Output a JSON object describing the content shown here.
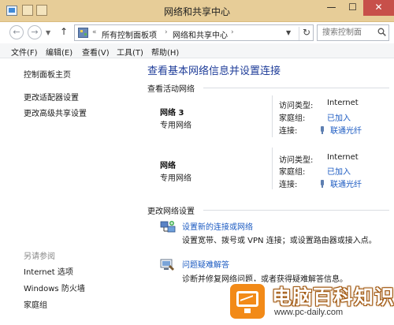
{
  "window": {
    "title": "网络和共享中心",
    "controls": {
      "minimize": "—",
      "maximize": "☐",
      "close": "✕"
    }
  },
  "address": {
    "crumbs": [
      "所有控制面板项",
      "网络和共享中心"
    ],
    "prefix": "«",
    "separator": "›",
    "search_placeholder": "搜索控制面"
  },
  "menu": [
    "文件(F)",
    "编辑(E)",
    "查看(V)",
    "工具(T)",
    "帮助(H)"
  ],
  "sidebar": {
    "items": [
      "控制面板主页",
      "更改适配器设置",
      "更改高级共享设置"
    ],
    "see_also_title": "另请参阅",
    "see_also": [
      "Internet 选项",
      "Windows 防火墙",
      "家庭组"
    ]
  },
  "main": {
    "heading": "查看基本网络信息并设置连接",
    "active_networks_label": "查看活动网络",
    "networks": [
      {
        "name": "网络 3",
        "type": "专用网络",
        "access_type_label": "访问类型:",
        "access_type": "Internet",
        "homegroup_label": "家庭组:",
        "homegroup": "已加入",
        "connection_label": "连接:",
        "connection": "联通光纤"
      },
      {
        "name": "网络",
        "type": "专用网络",
        "access_type_label": "访问类型:",
        "access_type": "Internet",
        "homegroup_label": "家庭组:",
        "homegroup": "已加入",
        "connection_label": "连接:",
        "connection": "联通光纤"
      }
    ],
    "change_settings_label": "更改网络设置",
    "tasks": [
      {
        "title": "设置新的连接或网络",
        "desc": "设置宽带、拨号或 VPN 连接；或设置路由器或接入点。",
        "icon": "new-connection-icon"
      },
      {
        "title": "问题疑难解答",
        "desc": "诊断并修复网络问题，或者获得疑难解答信息。",
        "icon": "troubleshoot-icon"
      }
    ]
  },
  "watermark": {
    "brand": "电脑百科知识",
    "url": "www.pc-daily.com"
  },
  "colors": {
    "titlebar": "#e7cd98",
    "close_button": "#c7504a",
    "link": "#1c5bc2",
    "heading": "#1f3d99",
    "watermark_orange": "#f28a18"
  }
}
